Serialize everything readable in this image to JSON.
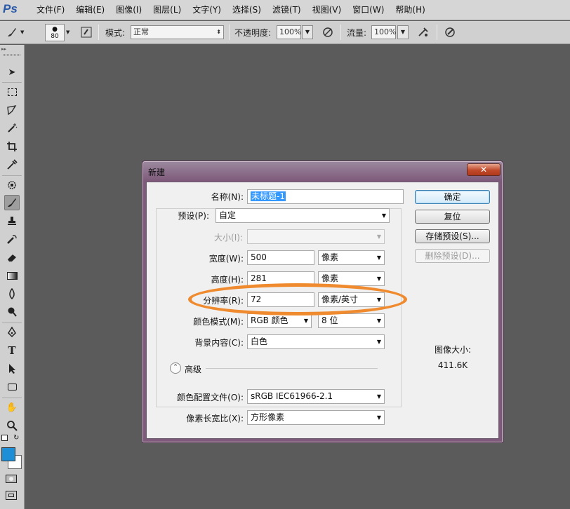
{
  "app": {
    "logo": "Ps"
  },
  "menu": [
    "文件(F)",
    "编辑(E)",
    "图像(I)",
    "图层(L)",
    "文字(Y)",
    "选择(S)",
    "滤镜(T)",
    "视图(V)",
    "窗口(W)",
    "帮助(H)"
  ],
  "options_bar": {
    "brush_size": "80",
    "mode_label": "模式:",
    "mode_value": "正常",
    "opacity_label": "不透明度:",
    "opacity_value": "100%",
    "flow_label": "流量:",
    "flow_value": "100%"
  },
  "dialog": {
    "title": "新建",
    "close_glyph": "✕",
    "name_label": "名称(N):",
    "name_value": "未标题-1",
    "preset_label": "预设(P):",
    "preset_value": "自定",
    "size_label": "大小(I):",
    "width_label": "宽度(W):",
    "width_value": "500",
    "width_unit": "像素",
    "height_label": "高度(H):",
    "height_value": "281",
    "height_unit": "像素",
    "resolution_label": "分辨率(R):",
    "resolution_value": "72",
    "resolution_unit": "像素/英寸",
    "color_mode_label": "颜色模式(M):",
    "color_mode_value": "RGB 颜色",
    "bit_depth_value": "8 位",
    "background_label": "背景内容(C):",
    "background_value": "白色",
    "advanced_label": "高级",
    "color_profile_label": "颜色配置文件(O):",
    "color_profile_value": "sRGB IEC61966-2.1",
    "pixel_aspect_label": "像素长宽比(X):",
    "pixel_aspect_value": "方形像素",
    "buttons": {
      "ok": "确定",
      "reset": "复位",
      "save_preset": "存储预设(S)...",
      "delete_preset": "删除预设(D)..."
    },
    "image_size_label": "图像大小:",
    "image_size_value": "411.6K"
  },
  "colors": {
    "workspace": "#5b5b5b",
    "foreground": "#1e8fd6",
    "background": "#ffffff",
    "annotation": "#ef8a2e"
  }
}
